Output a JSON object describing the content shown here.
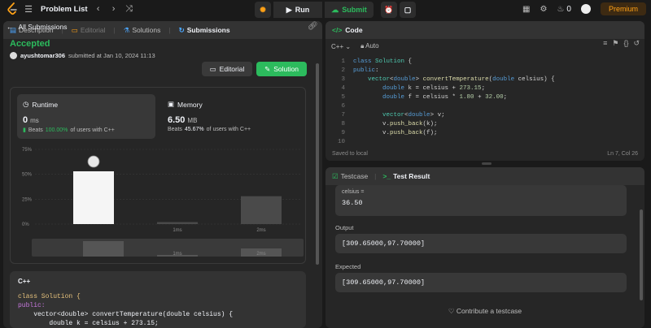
{
  "topbar": {
    "title": "Problem List",
    "run_label": "Run",
    "submit_label": "Submit",
    "notification_count": "0",
    "premium_label": "Premium"
  },
  "left_tabs": {
    "description": "Description",
    "editorial": "Editorial",
    "solutions": "Solutions",
    "submissions": "Submissions"
  },
  "submission": {
    "back_label": "All Submissions",
    "status": "Accepted",
    "user": "ayushtomar306",
    "submitted_text": "submitted at Jan 10, 2024 11:13",
    "editorial_button": "Editorial",
    "solution_button": "Solution"
  },
  "runtime": {
    "label": "Runtime",
    "value": "0",
    "unit": "ms",
    "beats_prefix": "Beats",
    "beats_pct": "100.00%",
    "beats_suffix": "of users with C++"
  },
  "memory": {
    "label": "Memory",
    "value": "6.50",
    "unit": "MB",
    "beats_prefix": "Beats",
    "beats_pct": "45.67%",
    "beats_suffix": "of users with C++"
  },
  "chart_data": {
    "type": "bar",
    "ylabel": "",
    "xlabel": "",
    "yticks": [
      "75%",
      "50%",
      "25%",
      "0%"
    ],
    "ylim": [
      0,
      75
    ],
    "categories": [
      "0ms",
      "1ms",
      "2ms"
    ],
    "x_tick_labels": [
      "",
      "1ms",
      "2ms"
    ],
    "values": [
      53,
      2,
      28
    ],
    "highlighted_index": 0,
    "grid": true,
    "overview_labels": [
      "1ms",
      "2ms"
    ]
  },
  "code_preview": {
    "language": "C++",
    "lines": [
      "class Solution {",
      "public:",
      "    vector<double> convertTemperature(double celsius) {",
      "        double k = celsius + 273.15;"
    ]
  },
  "editor": {
    "title": "Code",
    "language": "C++",
    "mode": "Auto",
    "saved_status": "Saved to local",
    "cursor_pos": "Ln 7, Col 26",
    "line_numbers": [
      "1",
      "2",
      "3",
      "4",
      "5",
      "6",
      "7",
      "8",
      "9",
      "10"
    ]
  },
  "results": {
    "testcase_tab": "Testcase",
    "result_tab": "Test Result",
    "input_label": "celsius =",
    "input_value": "36.50",
    "output_label": "Output",
    "output_value": "[309.65000,97.70000]",
    "expected_label": "Expected",
    "expected_value": "[309.65000,97.70000]",
    "contribute_label": "Contribute a testcase"
  },
  "colors": {
    "accent_green": "#2cbb5d",
    "premium_orange": "#ffa116",
    "background": "#1a1a1a",
    "panel": "#262626"
  }
}
